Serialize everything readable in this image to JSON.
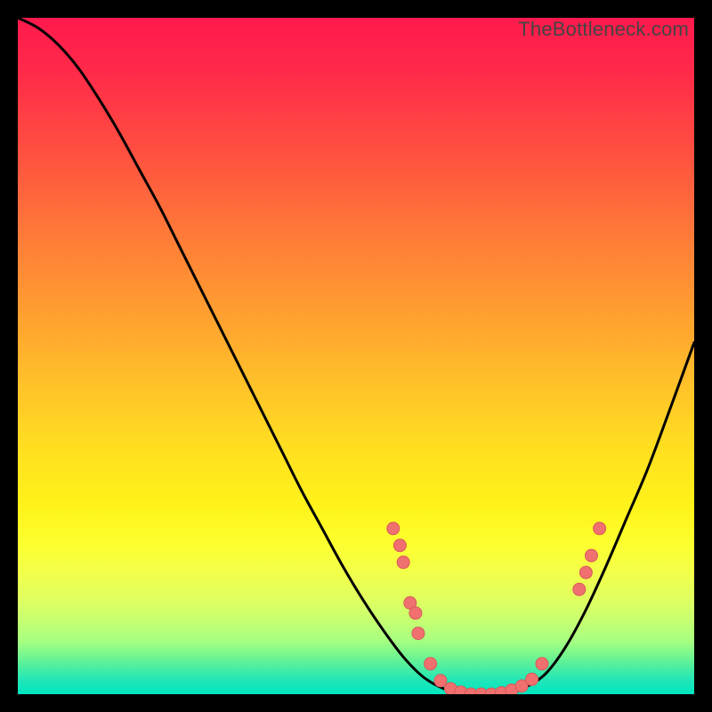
{
  "watermark": "TheBottleneck.com",
  "colors": {
    "curve": "#000000",
    "dot_fill": "#f07070",
    "dot_stroke": "#d85a5a"
  },
  "chart_data": {
    "type": "line",
    "title": "",
    "xlabel": "",
    "ylabel": "",
    "xlim": [
      0,
      100
    ],
    "ylim": [
      0,
      100
    ],
    "series": [
      {
        "name": "bottleneck-curve",
        "x": [
          0,
          3,
          6,
          9,
          12,
          15,
          18,
          21,
          24,
          27,
          30,
          33,
          36,
          39,
          42,
          45,
          48,
          51,
          54,
          57,
          60,
          63,
          66,
          69,
          72,
          75,
          78,
          81,
          84,
          87,
          90,
          93,
          96,
          100
        ],
        "y": [
          100,
          98.5,
          96,
          92.5,
          88,
          83,
          77.5,
          72,
          66,
          60,
          54,
          48,
          42,
          36,
          30,
          24.5,
          19,
          14,
          9.5,
          5.5,
          2.5,
          0.8,
          0,
          0,
          0,
          1,
          3,
          7,
          12.5,
          19,
          26,
          33,
          41,
          52
        ]
      }
    ],
    "points": [
      {
        "x": 55.5,
        "y": 24.5
      },
      {
        "x": 56.5,
        "y": 22
      },
      {
        "x": 57,
        "y": 19.5
      },
      {
        "x": 58,
        "y": 13.5
      },
      {
        "x": 58.8,
        "y": 12
      },
      {
        "x": 59.2,
        "y": 9
      },
      {
        "x": 61,
        "y": 4.5
      },
      {
        "x": 62.5,
        "y": 2
      },
      {
        "x": 64,
        "y": 0.8
      },
      {
        "x": 65.5,
        "y": 0.3
      },
      {
        "x": 67,
        "y": 0
      },
      {
        "x": 68.5,
        "y": 0
      },
      {
        "x": 70,
        "y": 0
      },
      {
        "x": 71.5,
        "y": 0.2
      },
      {
        "x": 73,
        "y": 0.6
      },
      {
        "x": 74.5,
        "y": 1.2
      },
      {
        "x": 76,
        "y": 2.2
      },
      {
        "x": 77.5,
        "y": 4.5
      },
      {
        "x": 83,
        "y": 15.5
      },
      {
        "x": 84,
        "y": 18
      },
      {
        "x": 84.8,
        "y": 20.5
      },
      {
        "x": 86,
        "y": 24.5
      }
    ],
    "dot_radius": 7
  }
}
